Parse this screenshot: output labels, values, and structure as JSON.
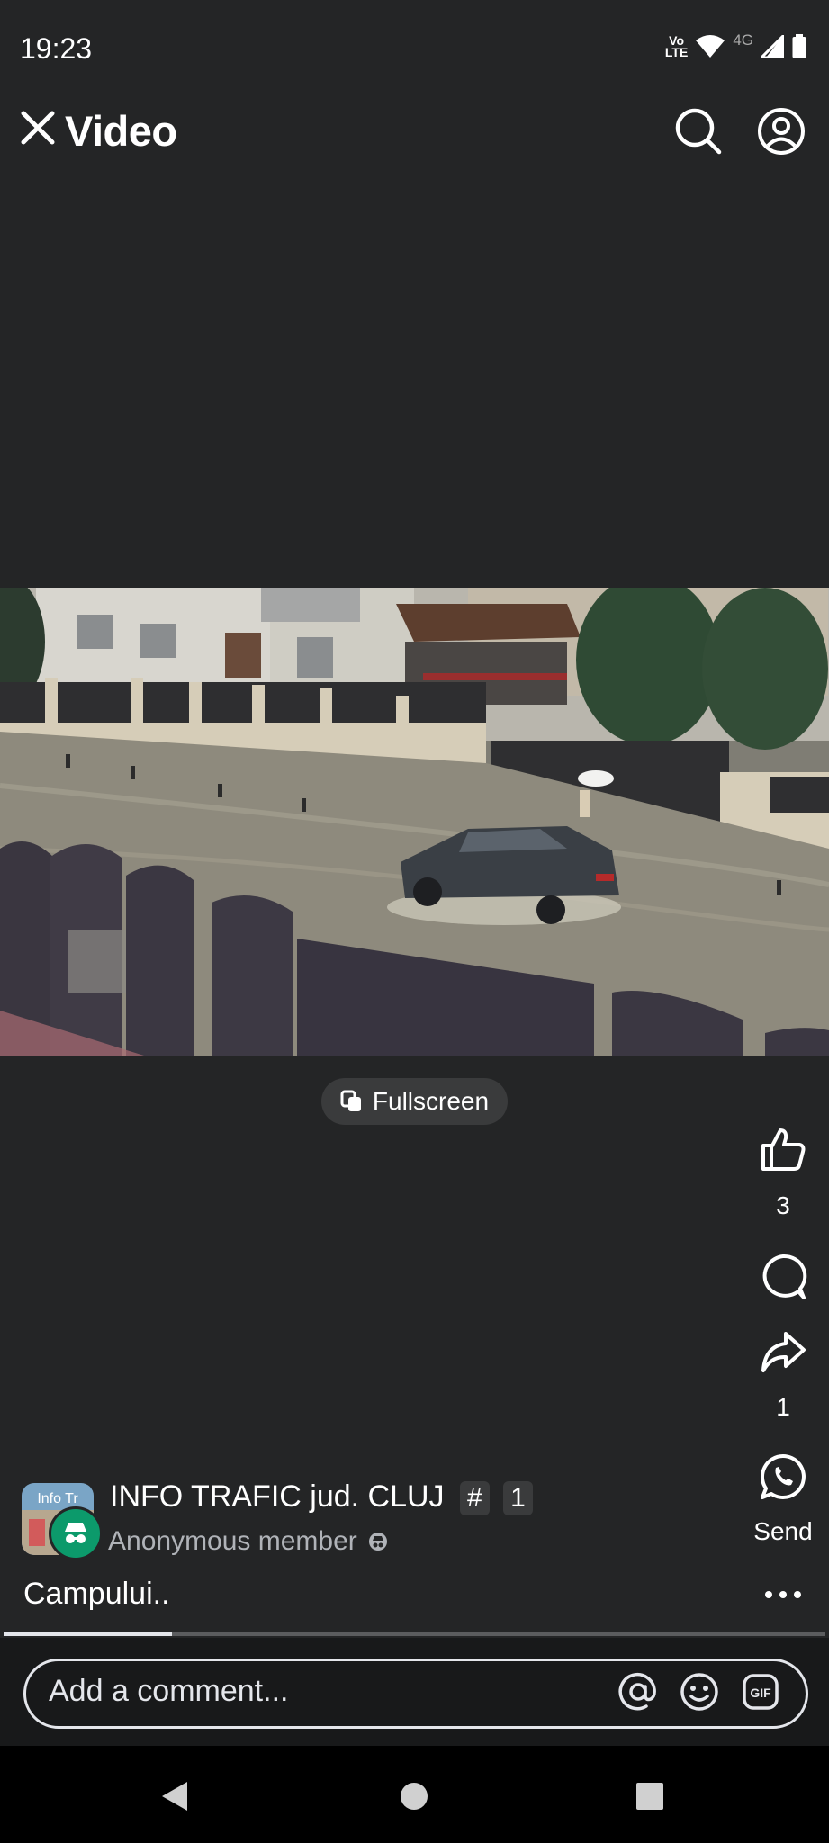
{
  "status_bar": {
    "time": "19:23",
    "volte_top": "Vo",
    "volte_bottom": "LTE",
    "network": "4G",
    "icons": [
      "volte-icon",
      "wifi-icon",
      "signal-icon",
      "battery-icon"
    ]
  },
  "header": {
    "title": "Video",
    "icons": [
      "close-icon",
      "search-icon",
      "profile-icon"
    ]
  },
  "video": {
    "fullscreen_label": "Fullscreen",
    "progress": 0.205
  },
  "actions": {
    "like_count": "3",
    "share_count": "1",
    "send_label": "Send",
    "icons": [
      "like-icon",
      "comment-icon",
      "share-icon",
      "whatsapp-icon"
    ]
  },
  "post": {
    "group_name": "INFO TRAFIC jud. CLUJ",
    "tag_hash": "#",
    "tag_number": "1",
    "author": "Anonymous member",
    "caption": "Campului..",
    "avatar_text": "Info Tr"
  },
  "comment": {
    "placeholder": "Add a comment...",
    "gif_label": "GIF",
    "icons": [
      "mention-icon",
      "emoji-icon",
      "gif-icon"
    ]
  },
  "navbar": {
    "icons": [
      "back-icon",
      "home-icon",
      "recents-icon"
    ]
  },
  "colors": {
    "background": "#242526",
    "text": "#ffffff",
    "secondary_text": "#b0b3b8",
    "anonymous_badge": "#0c9a6b"
  }
}
